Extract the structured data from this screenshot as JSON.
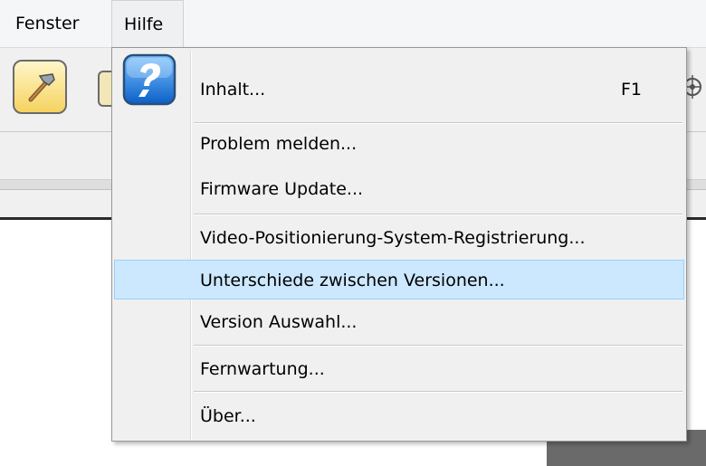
{
  "menubar": {
    "items": [
      {
        "label": "Fenster"
      },
      {
        "label": "Hilfe"
      }
    ]
  },
  "toolbar": {
    "icons": [
      "hammer-icon",
      "target-icon"
    ]
  },
  "help_menu": {
    "icon": "help-question-icon",
    "items": [
      {
        "label": "Inhalt...",
        "shortcut": "F1"
      },
      {
        "label": "Problem melden..."
      },
      {
        "label": "Firmware Update..."
      },
      {
        "label": "Video-Positionierung-System-Registrierung..."
      },
      {
        "label": "Unterschiede zwischen Versionen...",
        "highlighted": true
      },
      {
        "label": "Version Auswahl..."
      },
      {
        "label": "Fernwartung..."
      },
      {
        "label": "Über..."
      }
    ]
  },
  "colors": {
    "highlight_bg": "#cce8ff",
    "highlight_border": "#99d1ff",
    "menu_bg": "#f0f0f0"
  }
}
